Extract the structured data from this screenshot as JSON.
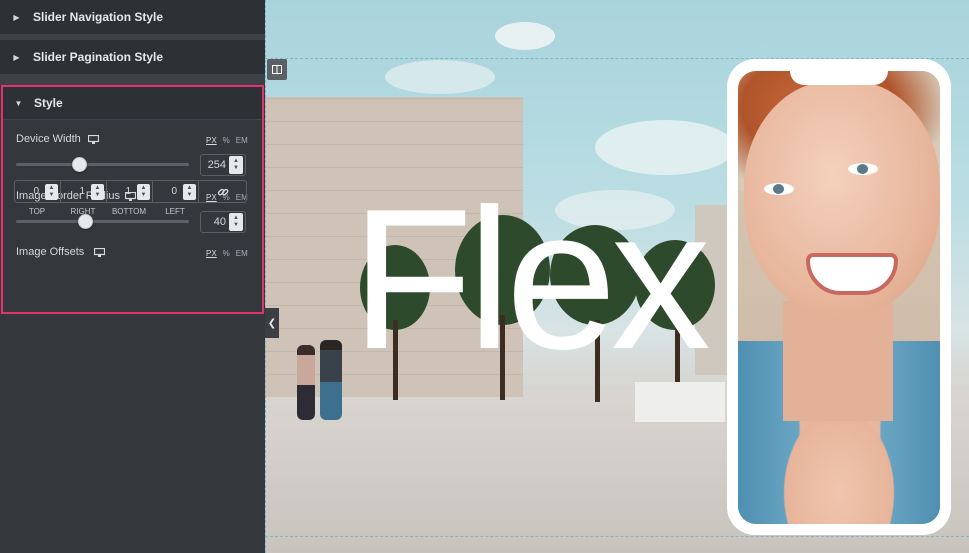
{
  "panel": {
    "sections": {
      "nav_style": "Slider Navigation Style",
      "pagination_style": "Slider Pagination Style",
      "style": "Style"
    },
    "units": {
      "px": "PX",
      "percent": "%",
      "em": "EM"
    },
    "device_width": {
      "label": "Device Width",
      "value": "254",
      "slider_fraction": 0.33
    },
    "image_border_radius": {
      "label": "Image Border Radius",
      "value": "40",
      "slider_fraction": 0.37
    },
    "image_offsets": {
      "label": "Image Offsets",
      "top": "0",
      "right": "1",
      "bottom": "1",
      "left": "0",
      "labels": {
        "top": "TOP",
        "right": "RIGHT",
        "bottom": "BOTTOM",
        "left": "LEFT"
      }
    }
  },
  "preview": {
    "headline": "Flex"
  },
  "icons": {
    "caret_right": "caret-right-icon",
    "caret_down": "caret-down-icon",
    "monitor": "monitor-icon",
    "link": "link-icon",
    "column": "column-handle-icon",
    "collapse": "chevron-left-icon"
  },
  "colors": {
    "highlight_border": "#e2336b",
    "panel_bg": "#34383c",
    "section_bg": "#2d3035"
  }
}
